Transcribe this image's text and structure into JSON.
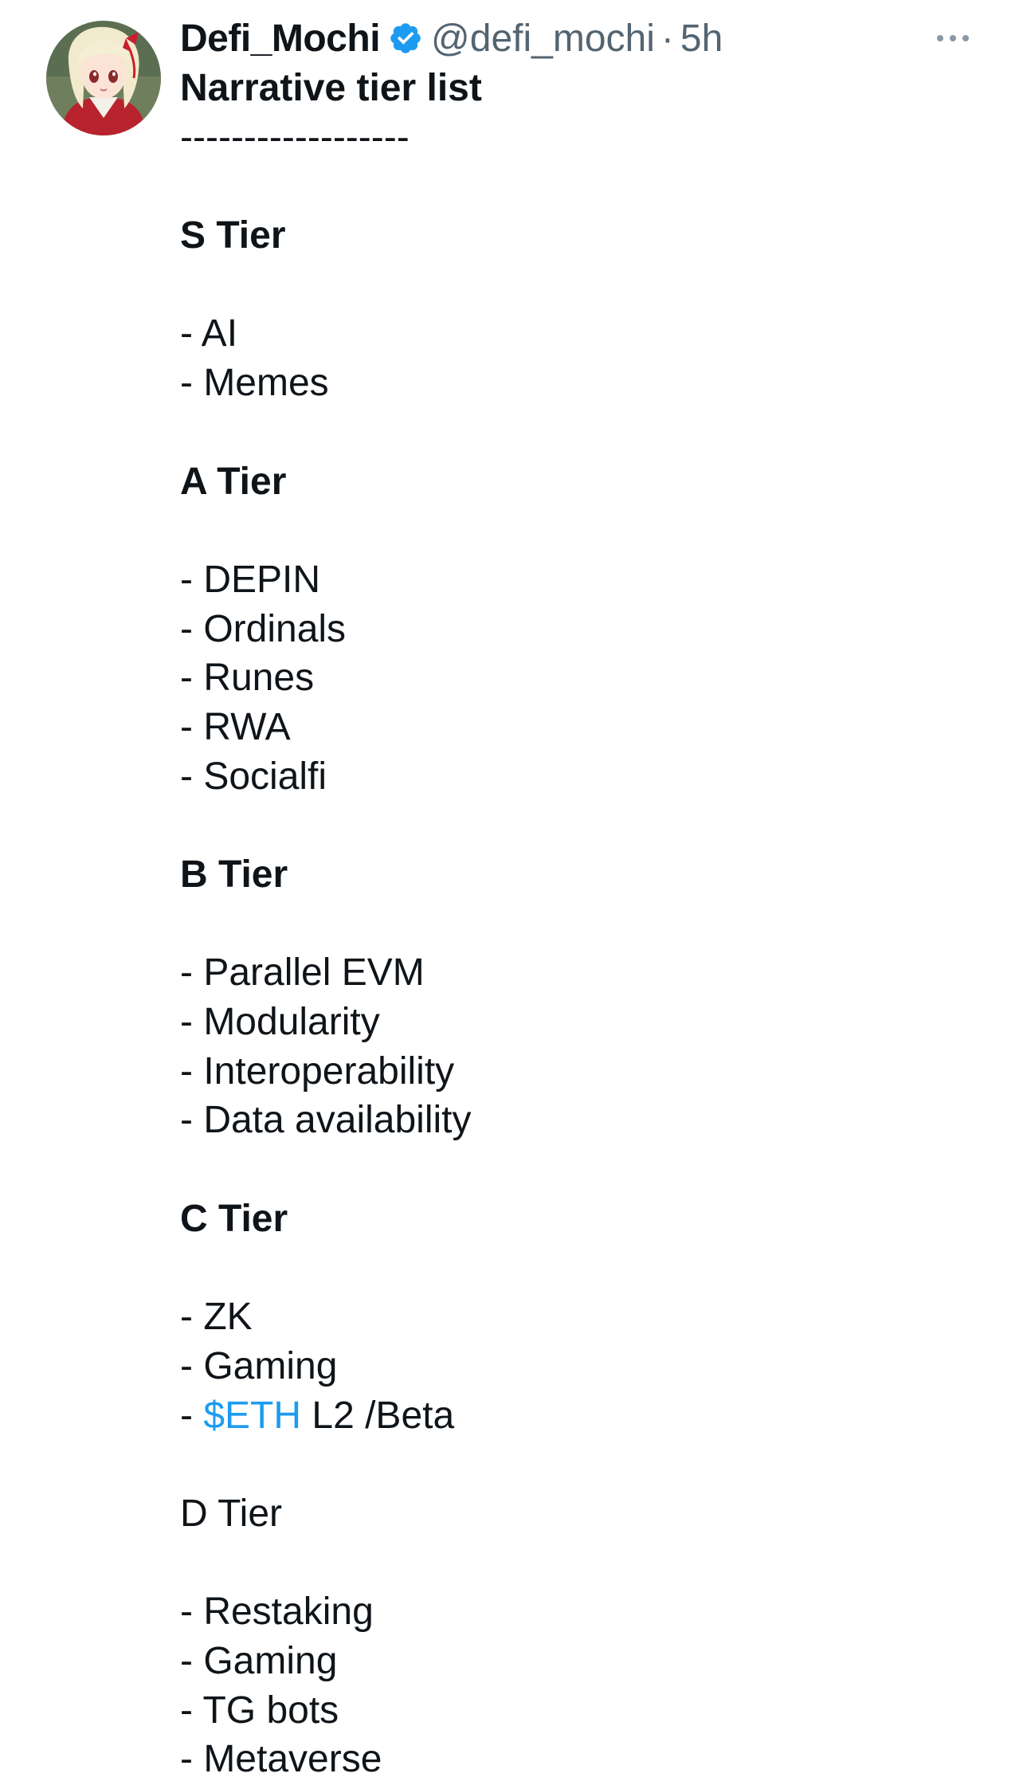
{
  "tweet": {
    "author": {
      "display_name": "Defi_Mochi",
      "handle": "@defi_mochi",
      "separator": "·",
      "time": "5h",
      "verified_icon": "verified-badge-icon",
      "avatar_icon": "anime-avatar"
    },
    "more_icon": "more-dots-icon",
    "colors": {
      "text": "#0f1419",
      "secondary": "#536471",
      "link": "#1d9bf0",
      "verified": "#1d9bf0"
    },
    "lines": {
      "title": "Narrative tier list",
      "divider": "------------------",
      "s_tier": "S Tier",
      "s1": "- AI",
      "s2": "- Memes",
      "a_tier": "A Tier",
      "a1": "- DEPIN",
      "a2": "- Ordinals",
      "a3": "- Runes",
      "a4": "- RWA",
      "a5": "- Socialfi",
      "b_tier": "B Tier",
      "b1": "- Parallel EVM",
      "b2": "- Modularity",
      "b3": "- Interoperability",
      "b4": "- Data availability",
      "c_tier": "C Tier",
      "c1": "- ZK",
      "c2": "- Gaming",
      "c3_prefix": "- ",
      "c3_cashtag": "$ETH",
      "c3_suffix": " L2 /Beta",
      "d_tier": "D Tier",
      "d1": "- Restaking",
      "d2": "- Gaming",
      "d3": "- TG bots",
      "d4": "- Metaverse"
    }
  }
}
